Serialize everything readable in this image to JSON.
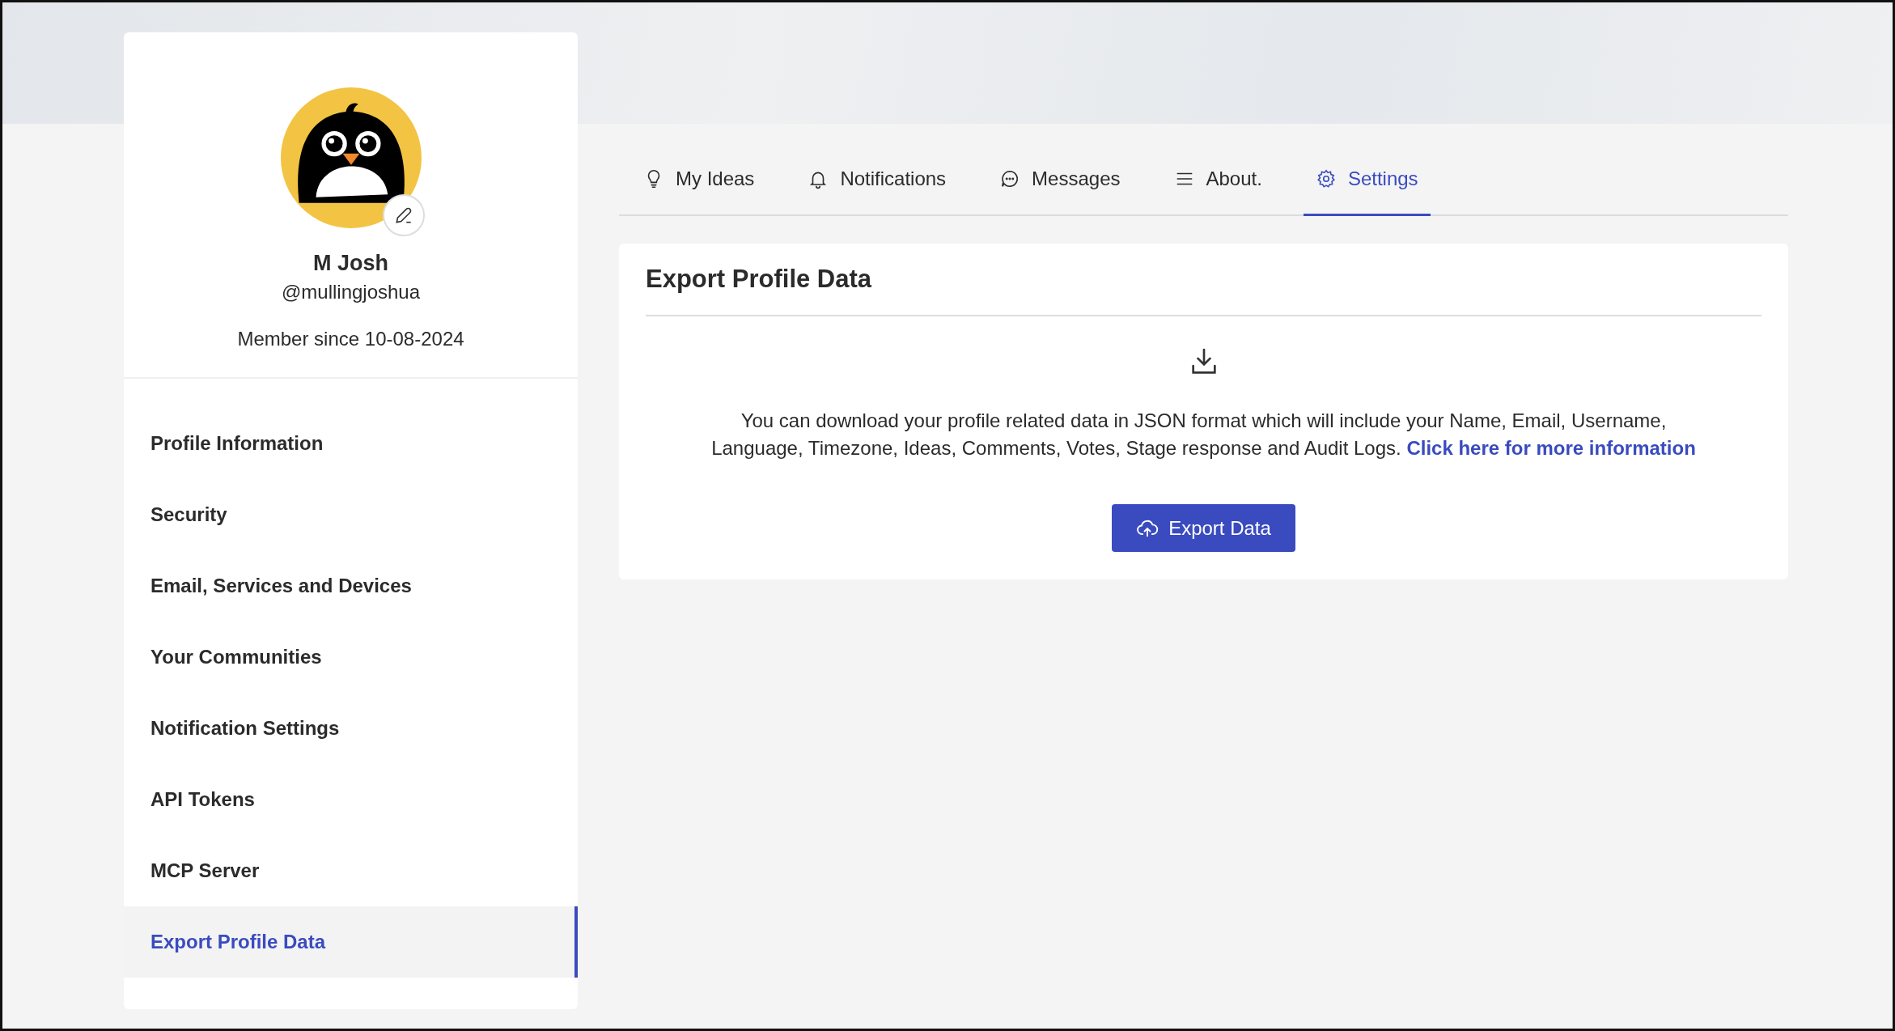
{
  "profile": {
    "name": "M Josh",
    "username": "@mullingjoshua",
    "member_since": "Member since 10-08-2024"
  },
  "sidebar": {
    "items": [
      {
        "label": "Profile Information",
        "selected": false
      },
      {
        "label": "Security",
        "selected": false
      },
      {
        "label": "Email, Services and Devices",
        "selected": false
      },
      {
        "label": "Your Communities",
        "selected": false
      },
      {
        "label": "Notification Settings",
        "selected": false
      },
      {
        "label": "API Tokens",
        "selected": false
      },
      {
        "label": "MCP Server",
        "selected": false
      },
      {
        "label": "Export Profile Data",
        "selected": true
      }
    ]
  },
  "tabs": [
    {
      "label": "My Ideas",
      "selected": false
    },
    {
      "label": "Notifications",
      "selected": false
    },
    {
      "label": "Messages",
      "selected": false
    },
    {
      "label": "About.",
      "selected": false
    },
    {
      "label": "Settings",
      "selected": true
    }
  ],
  "panel": {
    "title": "Export Profile Data",
    "description": "You can download your profile related data in JSON format which will include your Name, Email, Username, Language, Timezone, Ideas, Comments, Votes, Stage response and Audit Logs.",
    "link": "Click here for more information",
    "button": "Export Data"
  }
}
